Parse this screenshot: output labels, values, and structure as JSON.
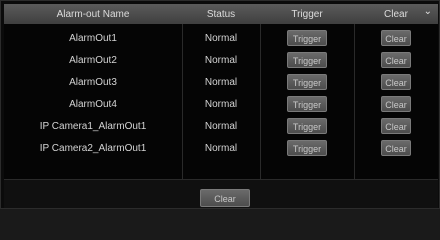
{
  "table": {
    "headers": {
      "name": "Alarm-out Name",
      "status": "Status",
      "trigger": "Trigger",
      "clear": "Clear"
    },
    "rows": [
      {
        "name": "AlarmOut1",
        "status": "Normal",
        "trigger_label": "Trigger",
        "clear_label": "Clear"
      },
      {
        "name": "AlarmOut2",
        "status": "Normal",
        "trigger_label": "Trigger",
        "clear_label": "Clear"
      },
      {
        "name": "AlarmOut3",
        "status": "Normal",
        "trigger_label": "Trigger",
        "clear_label": "Clear"
      },
      {
        "name": "AlarmOut4",
        "status": "Normal",
        "trigger_label": "Trigger",
        "clear_label": "Clear"
      },
      {
        "name": "IP Camera1_AlarmOut1",
        "status": "Normal",
        "trigger_label": "Trigger",
        "clear_label": "Clear"
      },
      {
        "name": "IP Camera2_AlarmOut1",
        "status": "Normal",
        "trigger_label": "Trigger",
        "clear_label": "Clear"
      }
    ]
  },
  "footer": {
    "clear_all_label": "Clear"
  },
  "icons": {
    "header_chevron": "chevron-down-icon"
  },
  "colors": {
    "background": "#0b0b0b",
    "header": "#4d4d4d",
    "button": "#5a5a5a",
    "text": "#d4d4d4"
  }
}
